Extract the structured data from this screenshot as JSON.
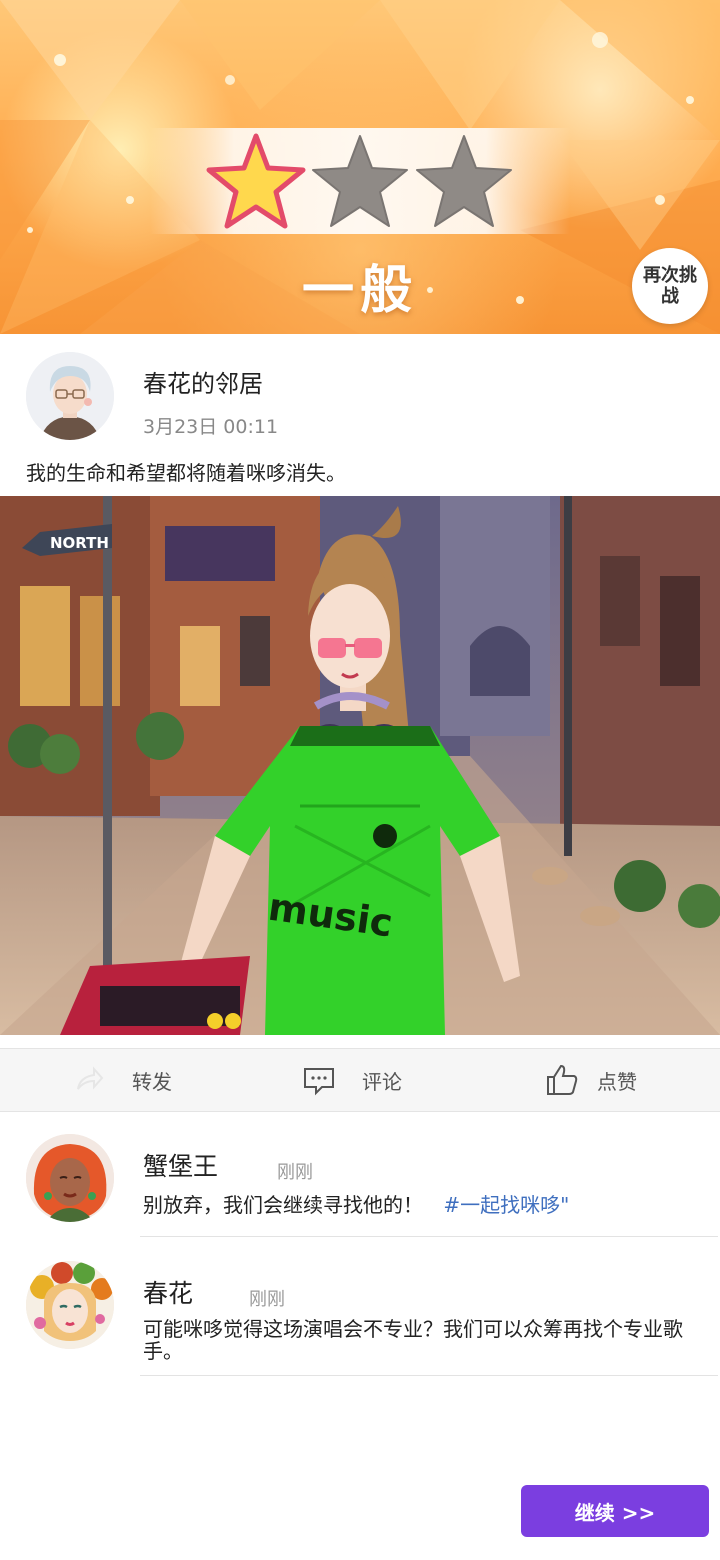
{
  "result": {
    "stars_earned": 1,
    "stars_total": 3,
    "rating_text": "一般",
    "retry_button": "再次挑战",
    "colors": {
      "star_filled": "#ffd84d",
      "star_empty": "#8f8a86",
      "banner": "#ffae52"
    }
  },
  "post": {
    "author": "春花的邻居",
    "time": "3月23日 00:11",
    "text": "我的生命和希望都将随着咪哆消失。",
    "image_sign_text": "NORTH",
    "image_shirt_text": "music"
  },
  "actions": {
    "share": "转发",
    "comment": "评论",
    "like": "点赞"
  },
  "comments": [
    {
      "name": "蟹堡王",
      "time": "刚刚",
      "text": "别放弃，我们会继续寻找他的！",
      "hashtag": "#一起找咪哆\""
    },
    {
      "name": "春花",
      "time": "刚刚",
      "text": "可能咪哆觉得这场演唱会不专业？我们可以众筹再找个专业歌手。",
      "hashtag": ""
    }
  ],
  "continue_button": "继续 >>"
}
